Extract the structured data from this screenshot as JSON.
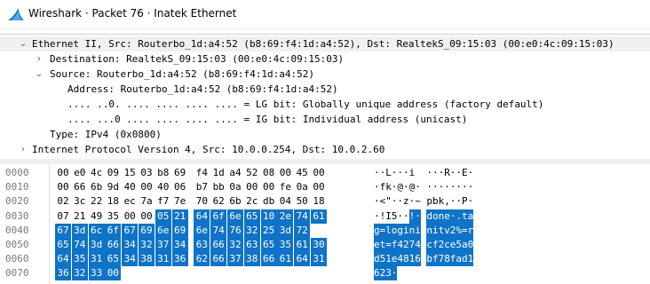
{
  "window": {
    "title": "Wireshark · Packet 76 · Inatek Ethernet",
    "icon": "wireshark-fin-icon"
  },
  "details": {
    "ethernet_header": "Ethernet II, Src: Routerbo_1d:a4:52 (b8:69:f4:1d:a4:52), Dst: RealtekS_09:15:03 (00:e0:4c:09:15:03)",
    "destination": "Destination: RealtekS_09:15:03 (00:e0:4c:09:15:03)",
    "source": "Source: Routerbo_1d:a4:52 (b8:69:f4:1d:a4:52)",
    "address": "Address: Routerbo_1d:a4:52 (b8:69:f4:1d:a4:52)",
    "lg_bit": ".... ..0. .... .... .... .... = LG bit: Globally unique address (factory default)",
    "ig_bit": ".... ...0 .... .... .... .... = IG bit: Individual address (unicast)",
    "type": "Type: IPv4 (0x0800)",
    "ip_header": "Internet Protocol Version 4, Src: 10.0.0.254, Dst: 10.0.2.60"
  },
  "bytes": {
    "rows": [
      {
        "offset": "0000",
        "hex": [
          "00",
          "e0",
          "4c",
          "09",
          "15",
          "03",
          "b8",
          "69",
          "f4",
          "1d",
          "a4",
          "52",
          "08",
          "00",
          "45",
          "00"
        ],
        "ascii": "··L···i ···R··E·",
        "hl_start": 16
      },
      {
        "offset": "0010",
        "hex": [
          "00",
          "66",
          "6b",
          "9d",
          "40",
          "00",
          "40",
          "06",
          "b7",
          "bb",
          "0a",
          "00",
          "00",
          "fe",
          "0a",
          "00"
        ],
        "ascii": "·fk·@·@· ········",
        "hl_start": 16
      },
      {
        "offset": "0020",
        "hex": [
          "02",
          "3c",
          "22",
          "18",
          "ec",
          "7a",
          "f7",
          "7e",
          "70",
          "62",
          "6b",
          "2c",
          "db",
          "04",
          "50",
          "18"
        ],
        "ascii": "·<\"··z·~ pbk,··P·",
        "hl_start": 16
      },
      {
        "offset": "0030",
        "hex": [
          "07",
          "21",
          "49",
          "35",
          "00",
          "00",
          "05",
          "21",
          "64",
          "6f",
          "6e",
          "65",
          "10",
          "2e",
          "74",
          "61"
        ],
        "ascii": "·!I5··!· done·.ta",
        "hl_start": 6
      },
      {
        "offset": "0040",
        "hex": [
          "67",
          "3d",
          "6c",
          "6f",
          "67",
          "69",
          "6e",
          "69",
          "6e",
          "74",
          "76",
          "32",
          "25",
          "3d",
          "72"
        ],
        "ascii": "g=logini nitv2%=r",
        "hl_start": 0
      },
      {
        "offset": "0050",
        "hex": [
          "65",
          "74",
          "3d",
          "66",
          "34",
          "32",
          "37",
          "34",
          "63",
          "66",
          "32",
          "63",
          "65",
          "35",
          "61",
          "30"
        ],
        "ascii": "et=f4274 cf2ce5a0",
        "hl_start": 0
      },
      {
        "offset": "0060",
        "hex": [
          "64",
          "35",
          "31",
          "65",
          "34",
          "38",
          "31",
          "36",
          "62",
          "66",
          "37",
          "38",
          "66",
          "61",
          "64",
          "31"
        ],
        "ascii": "d51e4816 bf78fad1",
        "hl_start": 0
      },
      {
        "offset": "0070",
        "hex": [
          "36",
          "32",
          "33",
          "00"
        ],
        "ascii": "623·",
        "hl_start": 0
      }
    ]
  }
}
